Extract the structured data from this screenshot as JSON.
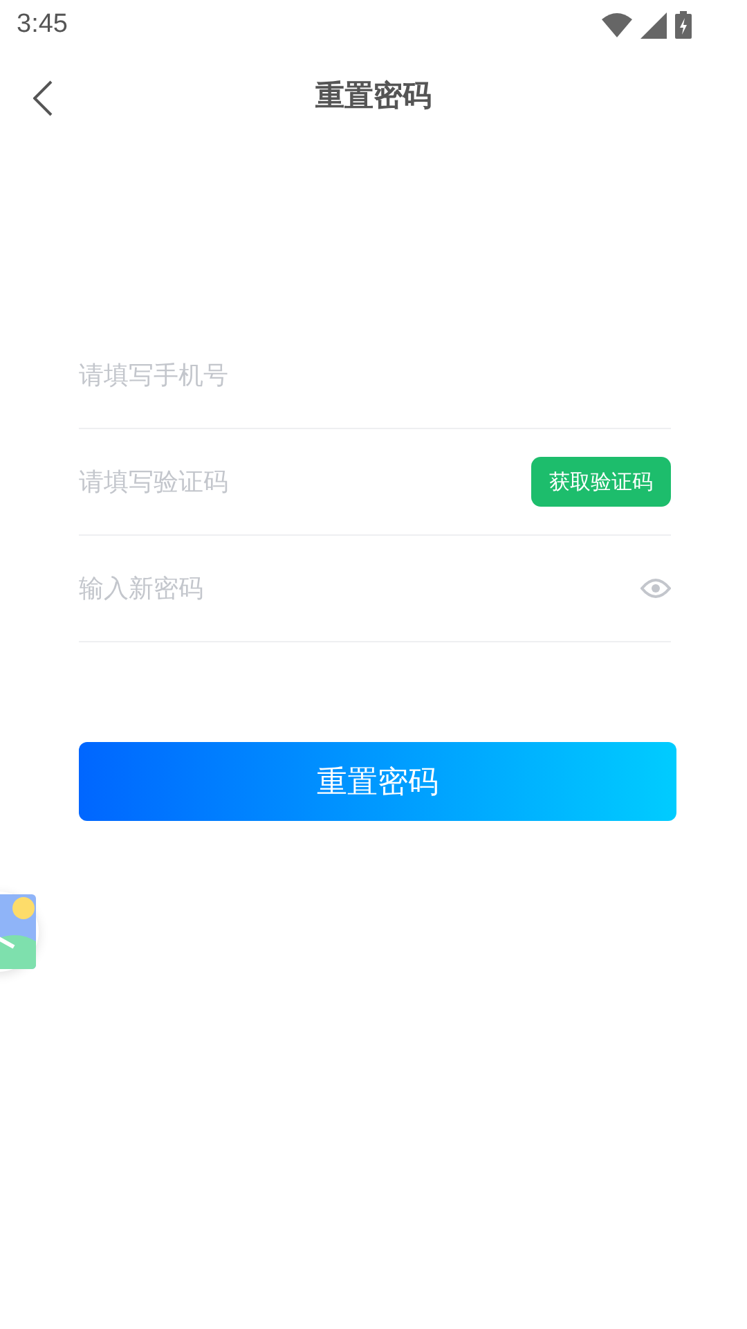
{
  "status_bar": {
    "time": "3:45"
  },
  "nav": {
    "title": "重置密码"
  },
  "fields": [
    {
      "kind": "text",
      "placeholder": "请填写手机号"
    },
    {
      "kind": "code",
      "placeholder": "请填写验证码",
      "action": "获取验证码"
    },
    {
      "kind": "password",
      "placeholder": "输入新密码"
    }
  ],
  "submit": "重置密码"
}
